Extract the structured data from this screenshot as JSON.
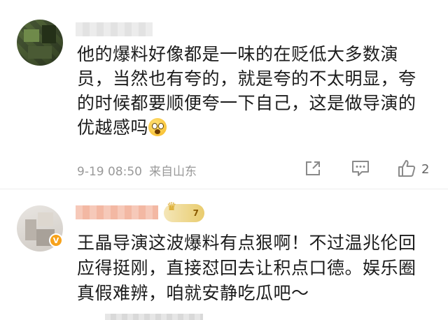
{
  "comments": [
    {
      "text_lines": [
        "他的爆料好像都是一味的在贬低大多数演",
        "员，当然也有夸的，就是夸的不太明显，夸",
        "的时候都要顺便夸一下自己，这是做导演的",
        "优越感吗"
      ],
      "emoji": "astonished-emoji",
      "date": "9-19 08:50",
      "location": "来自山东",
      "like_count": "2",
      "icons": {
        "share": "share-icon",
        "comment": "comment-icon",
        "like": "thumbs-up-icon"
      }
    },
    {
      "text_lines": [
        "王晶导演这波爆料有点狠啊！不过温兆伦回",
        "应得挺刚，直接怼回去让积点口德。娱乐圈",
        "真假难辨，咱就安静吃瓜吧～"
      ],
      "verified_badge": "V",
      "level_badge": "7"
    }
  ],
  "colors": {
    "text": "#1c1c1c",
    "meta": "#999999",
    "verified": "#f7a21b"
  }
}
